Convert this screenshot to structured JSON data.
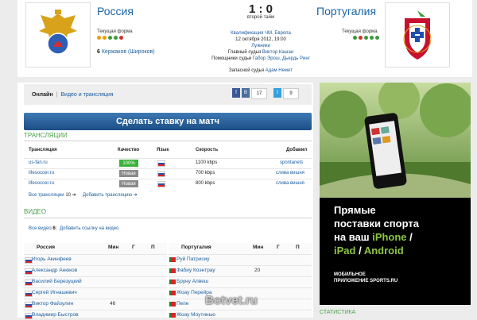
{
  "match": {
    "home": {
      "name": "Россия",
      "form_label": "Текущая форма",
      "form": [
        "#f29b00",
        "#f29b00",
        "#3a9a3a",
        "#3a9a3a",
        "#d23030"
      ],
      "scorer": "6",
      "scorer_name": "Кержаков",
      "assist": "(Широков)"
    },
    "away": {
      "name": "Португалия",
      "form_label": "Текущая форма",
      "form": [
        "#3a9a3a",
        "#d23030",
        "#3a9a3a",
        "#3a9a3a",
        "#3a9a3a"
      ]
    },
    "score": "1 : 0",
    "period": "второй тайм",
    "competition": "Квалификация ЧМ. Европа",
    "date": "12 октября 2012, 19:00",
    "venue": "Лужники",
    "referee_label": "Главный судья",
    "referee": "Виктор Кашаи",
    "assistants_label": "Помощники судьи",
    "assistants": "Габор Эрош, Дьердь Ринг",
    "reserve_label": "Запасной судья",
    "reserve": "Адам Немет"
  },
  "subnav": {
    "online": "Онлайн",
    "video": "Видео и трансляция",
    "fb": "f",
    "vk": "В",
    "vk_count": "17",
    "tw": "t",
    "tw_count": "9"
  },
  "bet_button": "Сделать ставку на матч",
  "broadcasts": {
    "title": "ТРАНСЛЯЦИИ",
    "headers": {
      "name": "Трансляция",
      "quality": "Качество",
      "lang": "Язык",
      "speed": "Скорость",
      "added": "Добавил"
    },
    "rows": [
      {
        "name": "us-fan.ru",
        "quality": "100%",
        "quality_color": "#3ab23a",
        "speed": "1100 kbps",
        "added": "spontanets"
      },
      {
        "name": "lifesoccer.ru",
        "quality": "Новая",
        "quality_color": "#8a8a8a",
        "speed": "700 kbps",
        "added": "слива вишня"
      },
      {
        "name": "lifesoccer.ru",
        "quality": "Новая",
        "quality_color": "#8a8a8a",
        "speed": "800 kbps",
        "added": "слива вишня"
      }
    ],
    "all_label": "Все трансляции",
    "all_count": "10 ➔",
    "add_label": "Добавить трансляцию ➔"
  },
  "video": {
    "title": "ВИДЕО",
    "all_label": "Все видео",
    "all_count": "6",
    "add_label": "Добавить ссылку на видео"
  },
  "lineups": {
    "home": {
      "title": "Россия",
      "cols": [
        "Мин",
        "Г",
        "П"
      ],
      "players": [
        {
          "name": "Игорь Акинфеев",
          "min": ""
        },
        {
          "name": "Александр Анюков",
          "min": ""
        },
        {
          "name": "Василий Березуцкий",
          "min": ""
        },
        {
          "name": "Сергей Игнашевич",
          "min": ""
        },
        {
          "name": "Виктор Файзулин",
          "min": "46"
        },
        {
          "name": "Владимир Быстров",
          "min": ""
        }
      ]
    },
    "away": {
      "title": "Португалия",
      "cols": [
        "Мин",
        "Г",
        "П"
      ],
      "players": [
        {
          "name": "Руй Патрисиу",
          "min": ""
        },
        {
          "name": "Фабиу Коэнтрау",
          "min": "20"
        },
        {
          "name": "Бруну Алвеш",
          "min": ""
        },
        {
          "name": "Жоау Перейра",
          "min": ""
        },
        {
          "name": "Пепе",
          "min": ""
        },
        {
          "name": "Жоау Моутинью",
          "min": ""
        }
      ]
    }
  },
  "ad": {
    "line1": "Прямые",
    "line2": "поставки спорта",
    "line3a": "на ваш ",
    "line3b": "iPhone",
    "line3c": " /",
    "line4a": "iPad",
    "line4b": " / ",
    "line4c": "Android",
    "footer1": "МОБИЛЬНОЕ",
    "footer2": "ПРИЛОЖЕНИЕ SPORTS.RU"
  },
  "statistics_title": "СТАТИСТИКА",
  "watermark": "Botvet.ru"
}
